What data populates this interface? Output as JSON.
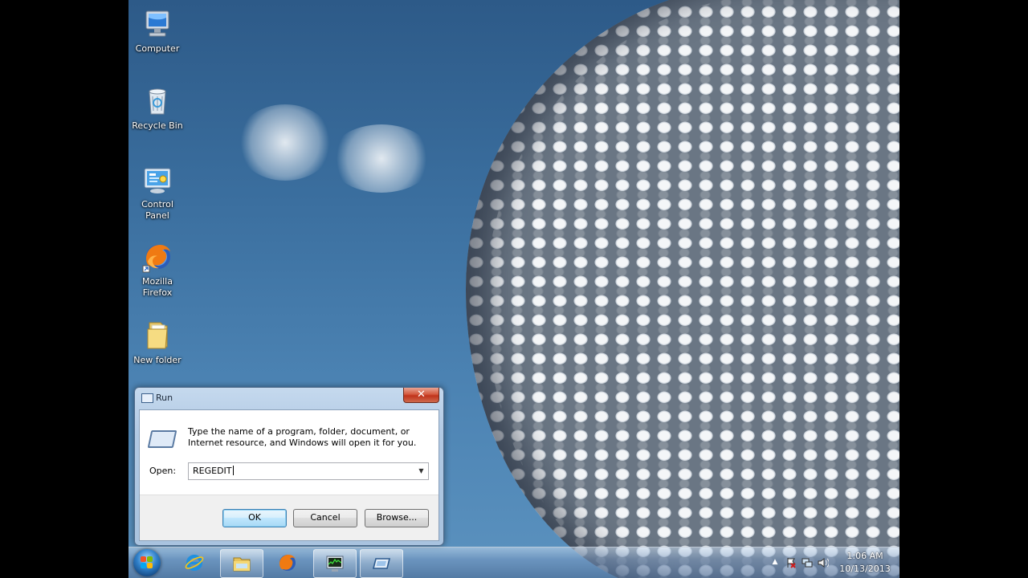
{
  "desktop": {
    "icons": [
      {
        "label": "Computer",
        "icon": "computer-icon"
      },
      {
        "label": "Recycle Bin",
        "icon": "recycle-bin-icon"
      },
      {
        "label": "Control Panel",
        "icon": "control-panel-icon"
      },
      {
        "label": "Mozilla Firefox",
        "icon": "firefox-icon"
      },
      {
        "label": "New folder",
        "icon": "folder-icon"
      }
    ]
  },
  "run_dialog": {
    "title": "Run",
    "close_label": "✕",
    "description": "Type the name of a program, folder, document, or Internet resource, and Windows will open it for you.",
    "open_label": "Open:",
    "open_value": "REGEDIT",
    "ok_label": "OK",
    "cancel_label": "Cancel",
    "browse_label": "Browse..."
  },
  "taskbar": {
    "items": [
      {
        "name": "internet-explorer",
        "icon": "internet-explorer-icon"
      },
      {
        "name": "windows-explorer",
        "icon": "folder-icon"
      },
      {
        "name": "firefox",
        "icon": "firefox-icon"
      },
      {
        "name": "task-manager",
        "icon": "task-manager-icon"
      },
      {
        "name": "run",
        "icon": "run-icon"
      }
    ],
    "clock": {
      "time": "1:06 AM",
      "date": "10/13/2013"
    }
  },
  "colors": {
    "desktop_blue": "#3b6f9f",
    "default_button": "#3c7fb1",
    "close_red": "#c0331b"
  }
}
